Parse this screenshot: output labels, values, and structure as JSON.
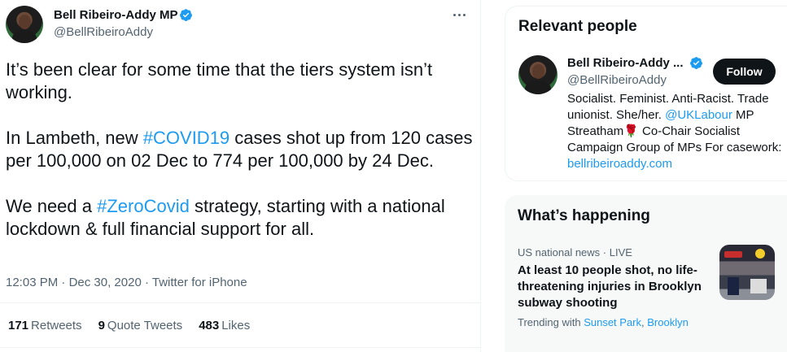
{
  "tweet": {
    "author_name": "Bell Ribeiro-Addy MP",
    "author_handle": "@BellRibeiroAddy",
    "text": {
      "p1": "It’s been clear for some time that the tiers system isn’t working.",
      "p2_before": "In Lambeth, new ",
      "p2_hashtag": "#COVID19",
      "p2_after": " cases shot up from 120 cases per 100,000 on 02 Dec to 774 per 100,000 by 24 Dec.",
      "p3_before": "We need a ",
      "p3_hashtag": "#ZeroCovid",
      "p3_after": " strategy, starting with a national lockdown & full financial support for all."
    },
    "time": "12:03 PM",
    "date": "Dec 30, 2020",
    "source": "Twitter for iPhone",
    "separator": " · ",
    "stats": {
      "retweets_count": "171",
      "retweets_label": "Retweets",
      "quote_count": "9",
      "quote_label": "Quote Tweets",
      "likes_count": "483",
      "likes_label": "Likes"
    }
  },
  "relevant_people": {
    "heading": "Relevant people",
    "name": "Bell Ribeiro-Addy ...",
    "handle": "@BellRibeiroAddy",
    "follow_label": "Follow",
    "bio": {
      "part1": "Socialist. Feminist. Anti-Racist. Trade unionist. She/her. ",
      "mention": "@UKLabour",
      "part2": " MP Streatham",
      "emoji": "🌹",
      "part3": " Co-Chair Socialist Campaign Group of MPs For casework: ",
      "link": "bellribeiroaddy.com"
    }
  },
  "whats_happening": {
    "heading": "What’s happening",
    "trend": {
      "context": "US national news · LIVE",
      "title": "At least 10 people shot, no life-threatening injuries in Brooklyn subway shooting",
      "trending_with_label": "Trending with",
      "tag1": "Sunset Park",
      "comma": ",",
      "tag2": "Brooklyn"
    }
  },
  "colors": {
    "accent": "#1d9bf0",
    "text_primary": "#0f1419",
    "text_secondary": "#536471",
    "follow_button": "#0f1419"
  },
  "icons": [
    "verified-badge-icon",
    "more-options-icon"
  ]
}
